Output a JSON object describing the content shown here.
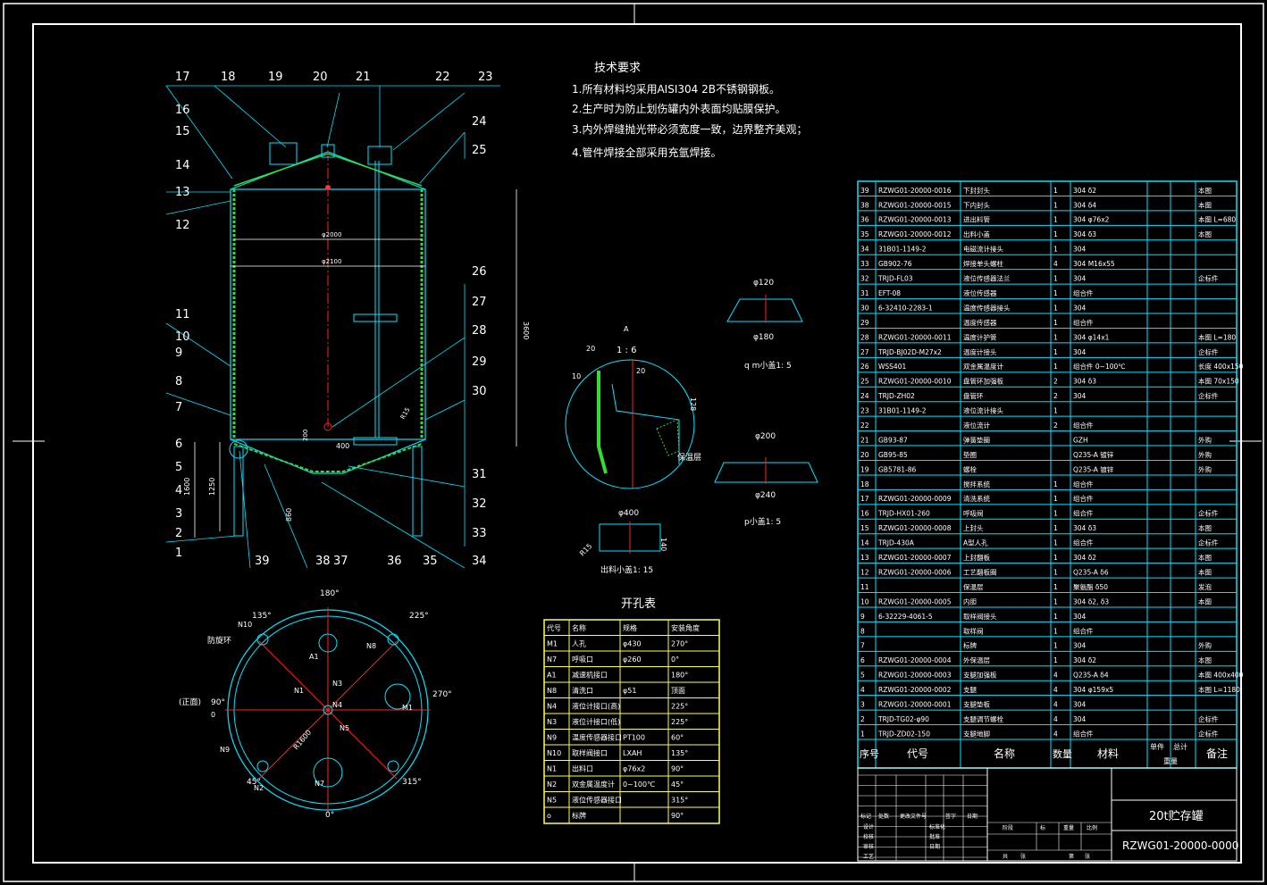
{
  "notes": {
    "title": "技术要求",
    "lines": [
      "1.所有材料均采用AISI304 2B不锈钢钢板。",
      "2.生产时为防止划伤罐内外表面均贴膜保护。",
      "3.内外焊缝抛光带必须宽度一致，边界整齐美观；",
      "4.管件焊接全部采用充氩焊接。"
    ]
  },
  "callouts_top": [
    "17",
    "18",
    "19",
    "20",
    "21",
    "22",
    "23",
    "24",
    "25",
    "16",
    "15",
    "14",
    "13",
    "12",
    "11",
    "10",
    "9",
    "8",
    "7",
    "6",
    "5",
    "4",
    "3",
    "2",
    "1"
  ],
  "callouts_bottom": [
    "39",
    "38",
    "37",
    "36",
    "35",
    "34",
    "33",
    "32",
    "31",
    "30",
    "29",
    "28",
    "27",
    "26"
  ],
  "dims": {
    "d2000": "φ2000",
    "d2100": "φ2100",
    "h3600": "3600",
    "h1600": "1600",
    "h1250": "1250",
    "h860": "860",
    "d400": "400",
    "d200": "200",
    "r15": "R15"
  },
  "detail": {
    "a_label": "A",
    "scale_a": "1 : 6",
    "d20a": "20",
    "d20b": "20",
    "d10": "10",
    "d128": "128",
    "insul": "保温层",
    "q_title": "q m小盖1: 5",
    "q_d120": "φ120",
    "q_d180": "φ180",
    "p_title": "p小盖1: 5",
    "p_d200": "φ200",
    "p_d240": "φ240",
    "o_title": "出料小盖1: 15",
    "o_d400": "φ400",
    "o_140": "140",
    "o_r15": "R15"
  },
  "plan": {
    "angles": [
      "180°",
      "135°",
      "225°",
      "90°",
      "270°",
      "45°",
      "315°",
      "0°"
    ],
    "labels": [
      "N10",
      "N9",
      "N8",
      "A1",
      "N3",
      "N4",
      "N1",
      "N2",
      "N7",
      "N5",
      "M1",
      "R1600"
    ],
    "front": "(正面)",
    "front_zero": "0",
    "ring": "防旋环"
  },
  "holes": {
    "title": "开孔表",
    "headers": [
      "代号",
      "名称",
      "规格",
      "安装角度"
    ],
    "rows": [
      [
        "M1",
        "人孔",
        "φ430",
        "270°"
      ],
      [
        "N7",
        "呼吸口",
        "φ260",
        "0°"
      ],
      [
        "A1",
        "减速机接口",
        "",
        "180°"
      ],
      [
        "N8",
        "清洗口",
        "φ51",
        "顶面"
      ],
      [
        "N4",
        "液位计接口(高)",
        "",
        "225°"
      ],
      [
        "N3",
        "液位计接口(低)",
        "",
        "225°"
      ],
      [
        "N9",
        "温度传感器接口",
        "PT100",
        "60°"
      ],
      [
        "N10",
        "取样阀接口",
        "LXAH",
        "135°"
      ],
      [
        "N1",
        "出料口",
        "φ76x2",
        "90°"
      ],
      [
        "N2",
        "双金属温度计",
        "0~100℃",
        "45°"
      ],
      [
        "N5",
        "液位传感器接口",
        "",
        "315°"
      ],
      [
        "o",
        "标牌",
        "",
        "90°"
      ]
    ]
  },
  "bom": {
    "rows": [
      [
        "39",
        "RZWG01-20000-0016",
        "下封封头",
        "1",
        "304 δ2",
        "",
        "本图"
      ],
      [
        "38",
        "RZWG01-20000-0015",
        "下内封头",
        "1",
        "304 δ4",
        "",
        "本图"
      ],
      [
        "36",
        "RZWG01-20000-0013",
        "进出料管",
        "1",
        "304 φ76x2",
        "",
        "本图 L=680"
      ],
      [
        "35",
        "RZWG01-20000-0012",
        "出料小盖",
        "1",
        "304 δ3",
        "",
        "本图"
      ],
      [
        "34",
        "31B01-1149-2",
        "电磁流计接头",
        "1",
        "304",
        "",
        ""
      ],
      [
        "33",
        "GB902-76",
        "焊接单头螺柱",
        "4",
        "304 M16x55",
        "",
        ""
      ],
      [
        "32",
        "TRJD-FL03",
        "液位传感器法兰",
        "1",
        "304",
        "",
        "企标件"
      ],
      [
        "31",
        "EFT-08",
        "液位传感器",
        "1",
        "组合件",
        "",
        ""
      ],
      [
        "30",
        "6-32410-2283-1",
        "温度传感器接头",
        "1",
        "304",
        "",
        ""
      ],
      [
        "29",
        "",
        "温度传感器",
        "1",
        "组合件",
        "",
        ""
      ],
      [
        "28",
        "RZWG01-20000-0011",
        "温度计护管",
        "1",
        "304 φ14x1",
        "",
        "本图 L=180"
      ],
      [
        "27",
        "TRJD-BJ02D-M27x2",
        "温度计接头",
        "1",
        "304",
        "",
        "企标件"
      ],
      [
        "26",
        "WSS401",
        "双金属温度计",
        "1",
        "组合件 0~100℃",
        "",
        "长度 400x150"
      ],
      [
        "25",
        "RZWG01-20000-0010",
        "盘管环加强板",
        "2",
        "304 δ3",
        "",
        "本图 70x150"
      ],
      [
        "24",
        "TRJD-ZH02",
        "盘管环",
        "2",
        "304",
        "",
        "企标件"
      ],
      [
        "23",
        "31B01-1149-2",
        "液位流计接头",
        "1",
        "",
        "",
        ""
      ],
      [
        "22",
        "",
        "液位流计",
        "2",
        "组合件",
        "",
        ""
      ],
      [
        "21",
        "GB93-87",
        "弹簧垫圈",
        "",
        "GZH",
        "",
        "外购"
      ],
      [
        "20",
        "GB95-85",
        "垫圈",
        "",
        "Q235-A 镀锌",
        "",
        "外购"
      ],
      [
        "19",
        "GB5781-86",
        "螺栓",
        "",
        "Q235-A 镀锌",
        "",
        "外购"
      ],
      [
        "18",
        "",
        "搅拌系统",
        "1",
        "组合件",
        "",
        ""
      ],
      [
        "17",
        "RZWG01-20000-0009",
        "清洗系统",
        "1",
        "组合件",
        "",
        ""
      ],
      [
        "16",
        "TRJD-HX01-260",
        "呼吸阀",
        "1",
        "组合件",
        "",
        "企标件"
      ],
      [
        "15",
        "RZWG01-20000-0008",
        "上封头",
        "1",
        "304 δ3",
        "",
        "本图"
      ],
      [
        "14",
        "TRJD-430A",
        "A型人孔",
        "1",
        "组合件",
        "",
        "企标件"
      ],
      [
        "13",
        "RZWG01-20000-0007",
        "上封翻板",
        "1",
        "304 δ2",
        "",
        "本图"
      ],
      [
        "12",
        "RZWG01-20000-0006",
        "工艺翻板圈",
        "1",
        "Q235-A δ6",
        "",
        "本图"
      ],
      [
        "11",
        "",
        "保温层",
        "1",
        "聚氨酯 δ50",
        "",
        "发泡"
      ],
      [
        "10",
        "RZWG01-20000-0005",
        "内胆",
        "1",
        "304 δ2, δ3",
        "",
        "本图"
      ],
      [
        "9",
        "6-32229-4061-5",
        "取样阀接头",
        "1",
        "304",
        "",
        ""
      ],
      [
        "8",
        "",
        "取样阀",
        "1",
        "组合件",
        "",
        ""
      ],
      [
        "7",
        "",
        "标牌",
        "1",
        "304",
        "",
        "外购"
      ],
      [
        "6",
        "RZWG01-20000-0004",
        "外保温层",
        "1",
        "304 δ2",
        "",
        "本图"
      ],
      [
        "5",
        "RZWG01-20000-0003",
        "支腿加强板",
        "4",
        "Q235-A δ4",
        "",
        "本图 400x400"
      ],
      [
        "4",
        "RZWG01-20000-0002",
        "支腿",
        "4",
        "304 φ159x5",
        "",
        "本图 L=1180"
      ],
      [
        "3",
        "RZWG01-20000-0001",
        "支腿垫板",
        "4",
        "304",
        "",
        ""
      ],
      [
        "2",
        "TRJD-TG02-φ90",
        "支腿调节螺栓",
        "4",
        "304",
        "",
        "企标件"
      ],
      [
        "1",
        "TRJD-ZD02-150",
        "支腿地脚",
        "4",
        "组合件",
        "",
        "企标件"
      ]
    ],
    "header": [
      "序号",
      "代号",
      "名称",
      "数量",
      "材料",
      "单件",
      "总计",
      "备注"
    ],
    "header_weight": "重量"
  },
  "titleblock": {
    "name": "20t贮存罐",
    "code": "RZWG01-20000-0000",
    "marks": [
      "标记",
      "处数",
      "更改文件号",
      "签字",
      "日期"
    ],
    "roles": [
      "设计",
      "校核",
      "审核",
      "工艺",
      "标准化",
      "批准",
      "日期"
    ],
    "stage": [
      "阶段",
      "标",
      "重量",
      "比例"
    ],
    "sheet": [
      "共",
      "张",
      "第",
      "张"
    ]
  }
}
